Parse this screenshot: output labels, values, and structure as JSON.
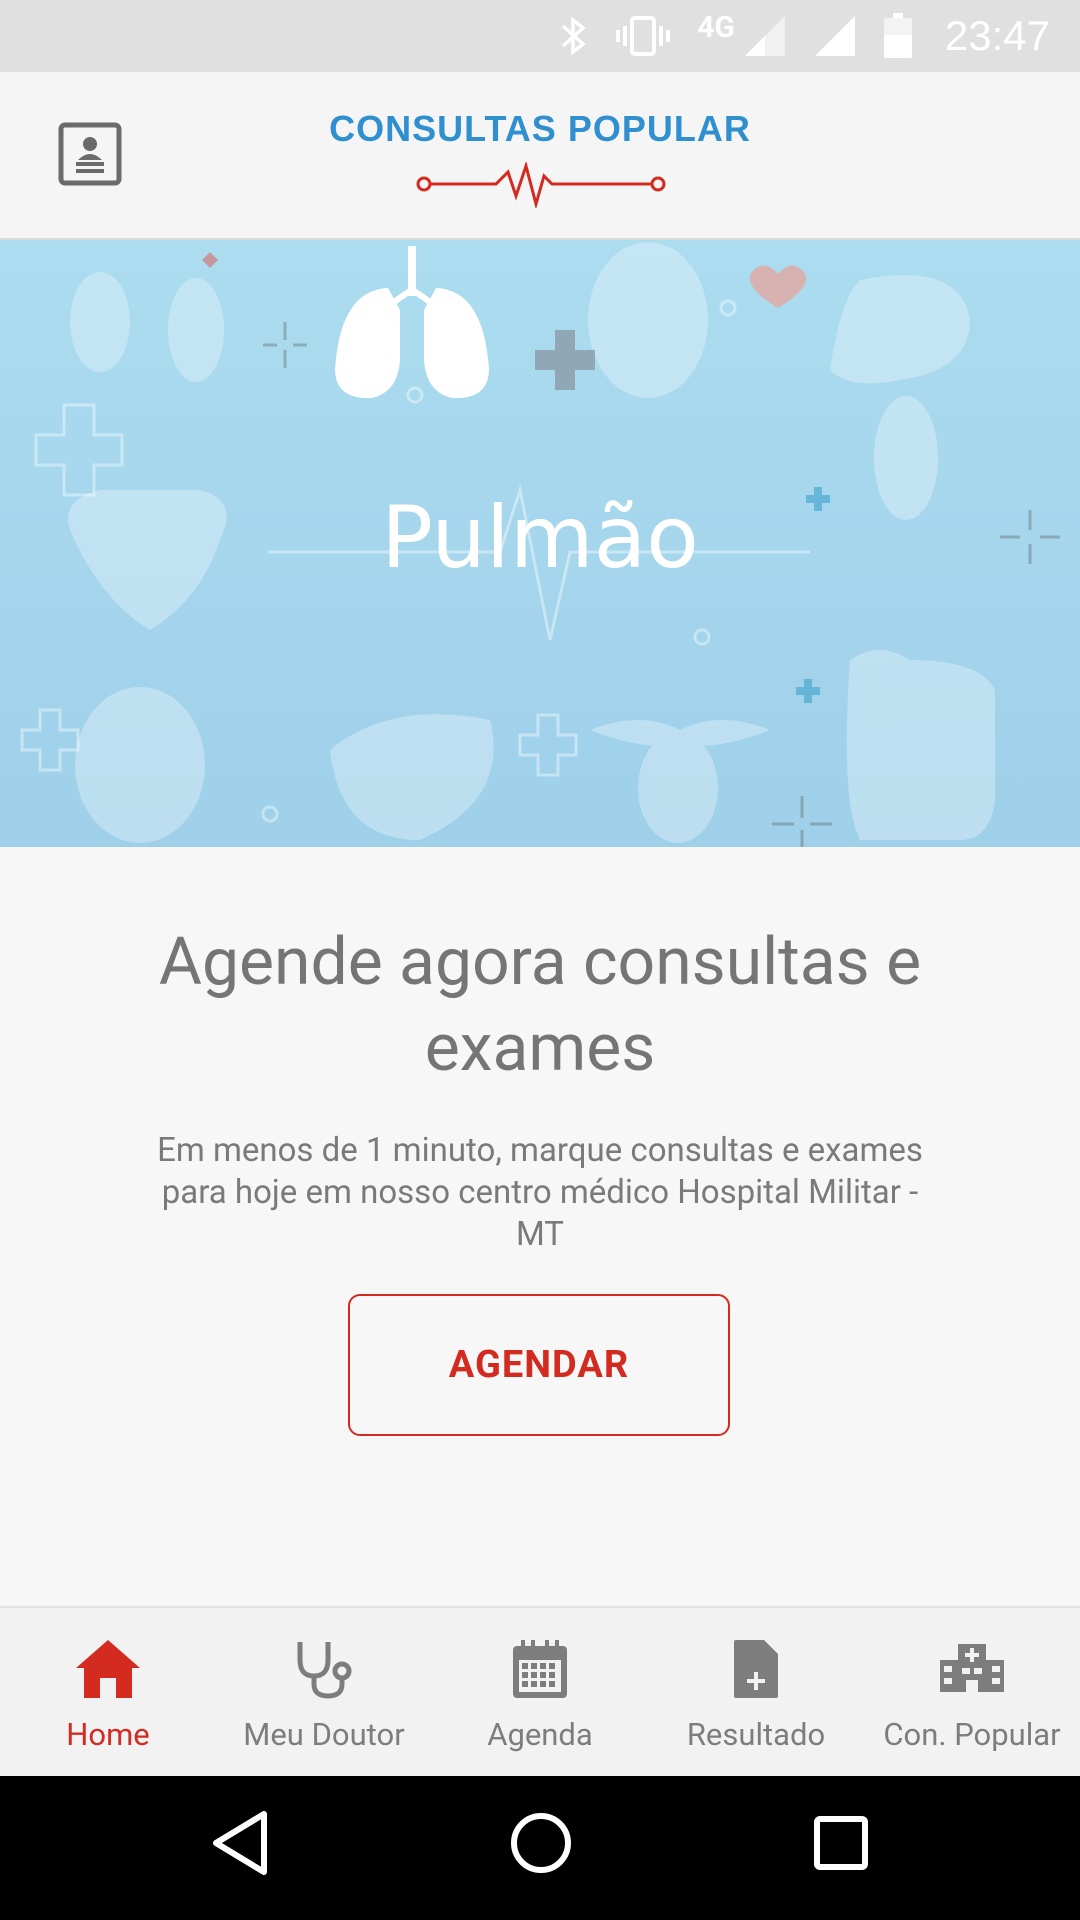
{
  "status_bar": {
    "network": "4G",
    "time": "23:47",
    "icons": [
      "bluetooth-icon",
      "vibrate-icon",
      "signal-icon",
      "signal-icon",
      "battery-icon"
    ]
  },
  "app_bar": {
    "logo_text": "CONSULTAS  POPULAR",
    "profile_icon": "profile-card-icon"
  },
  "hero": {
    "title": "Pulmão"
  },
  "content": {
    "headline": "Agende agora consultas e exames",
    "subtext": "Em menos de 1 minuto, marque consultas e exames para hoje em nosso centro médico Hospital Militar - MT",
    "button_label": "AGENDAR"
  },
  "bottom_nav": {
    "items": [
      {
        "label": "Home",
        "icon": "home-icon",
        "active": true
      },
      {
        "label": "Meu Doutor",
        "icon": "stethoscope-icon",
        "active": false
      },
      {
        "label": "Agenda",
        "icon": "calendar-icon",
        "active": false
      },
      {
        "label": "Resultado",
        "icon": "document-plus-icon",
        "active": false
      },
      {
        "label": "Con. Popular",
        "icon": "hospital-icon",
        "active": false
      }
    ]
  },
  "colors": {
    "accent": "#d32b1f",
    "brand_blue": "#2f8fcf",
    "hero_bg": "#a6d6ec",
    "muted_text": "#757575"
  }
}
